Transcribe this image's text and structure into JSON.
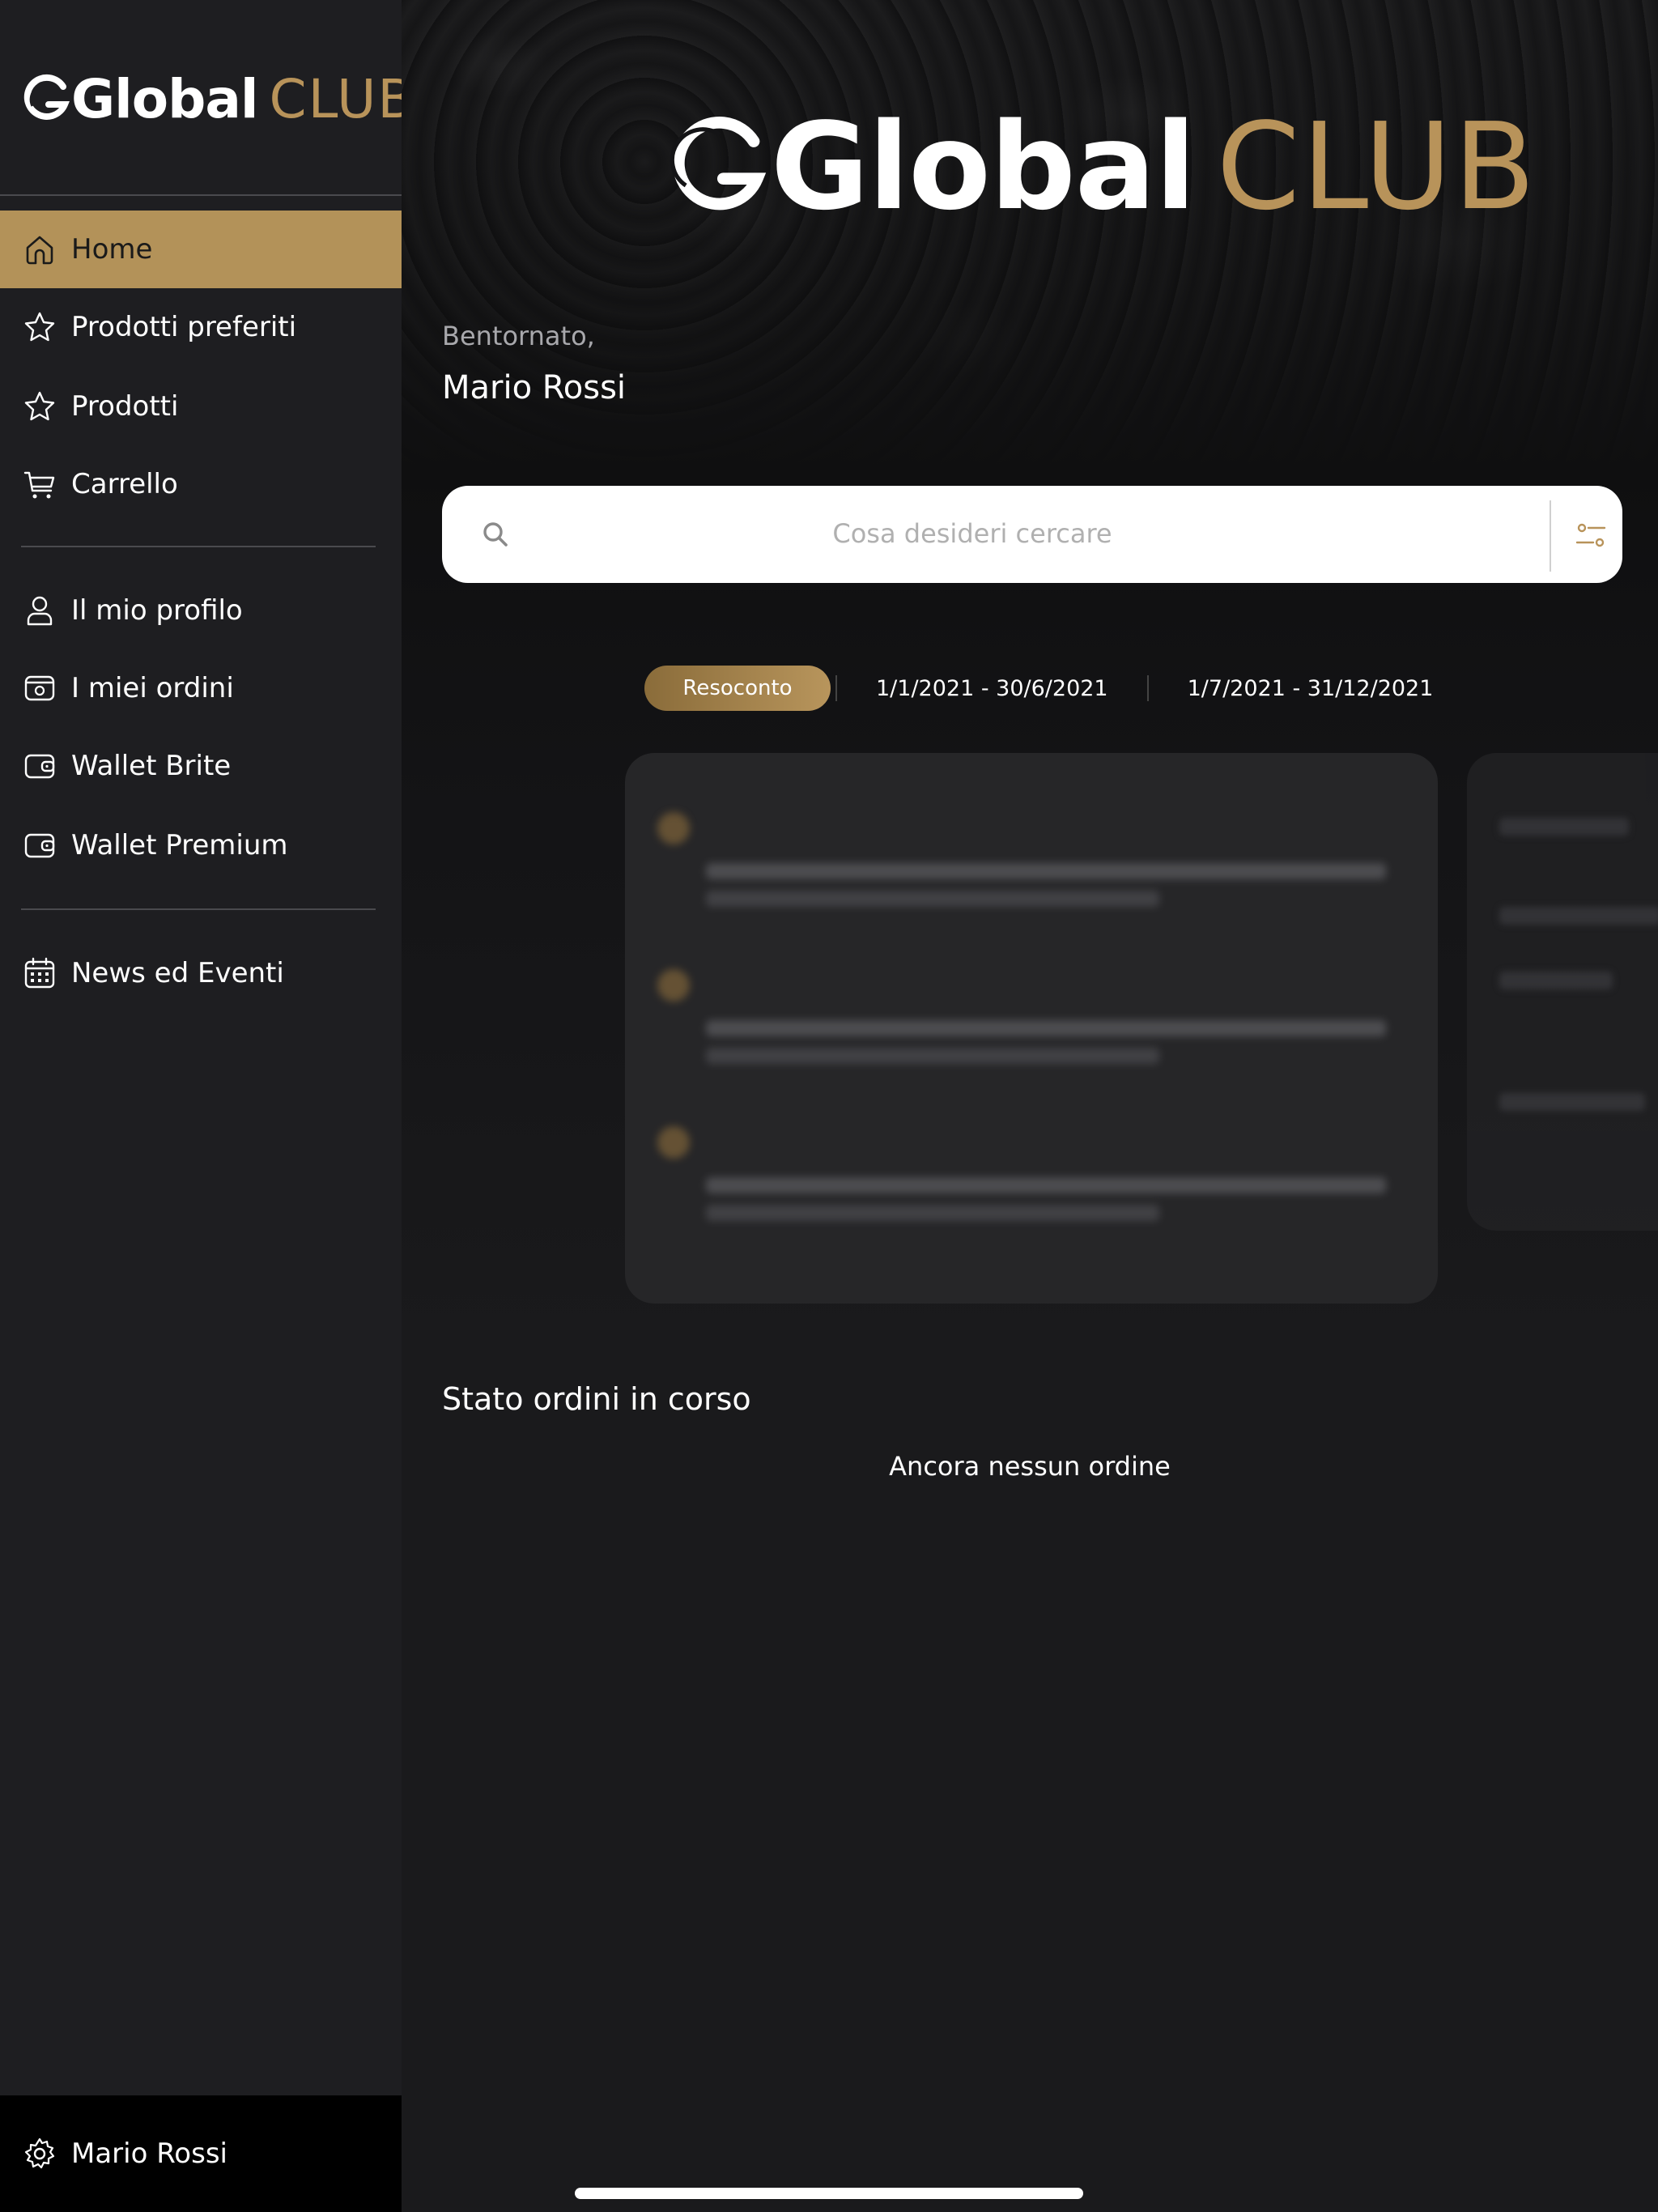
{
  "brand": {
    "word": "Global",
    "accent": "CLUB",
    "gold": "#b8935a"
  },
  "sidebar": {
    "items": [
      {
        "label": "Home",
        "icon": "home-icon",
        "active": true
      },
      {
        "label": "Prodotti preferiti",
        "icon": "star-icon"
      },
      {
        "label": "Prodotti",
        "icon": "star-icon"
      },
      {
        "label": "Carrello",
        "icon": "cart-icon"
      },
      {
        "label": "Il mio profilo",
        "icon": "user-icon"
      },
      {
        "label": "I miei ordini",
        "icon": "orders-icon"
      },
      {
        "label": "Wallet Brite",
        "icon": "wallet-icon"
      },
      {
        "label": "Wallet Premium",
        "icon": "wallet-icon"
      },
      {
        "label": "News ed Eventi",
        "icon": "calendar-icon"
      }
    ],
    "footer": {
      "label": "Mario Rossi",
      "icon": "gear-icon"
    }
  },
  "header": {
    "greeting": "Bentornato,",
    "username": "Mario Rossi"
  },
  "search": {
    "placeholder": "Cosa desideri cercare"
  },
  "tabs": [
    {
      "label": "Resoconto",
      "active": true
    },
    {
      "label": "1/1/2021 - 30/6/2021"
    },
    {
      "label": "1/7/2021 - 31/12/2021"
    }
  ],
  "orders": {
    "title": "Stato ordini in corso",
    "empty": "Ancora nessun ordine"
  }
}
